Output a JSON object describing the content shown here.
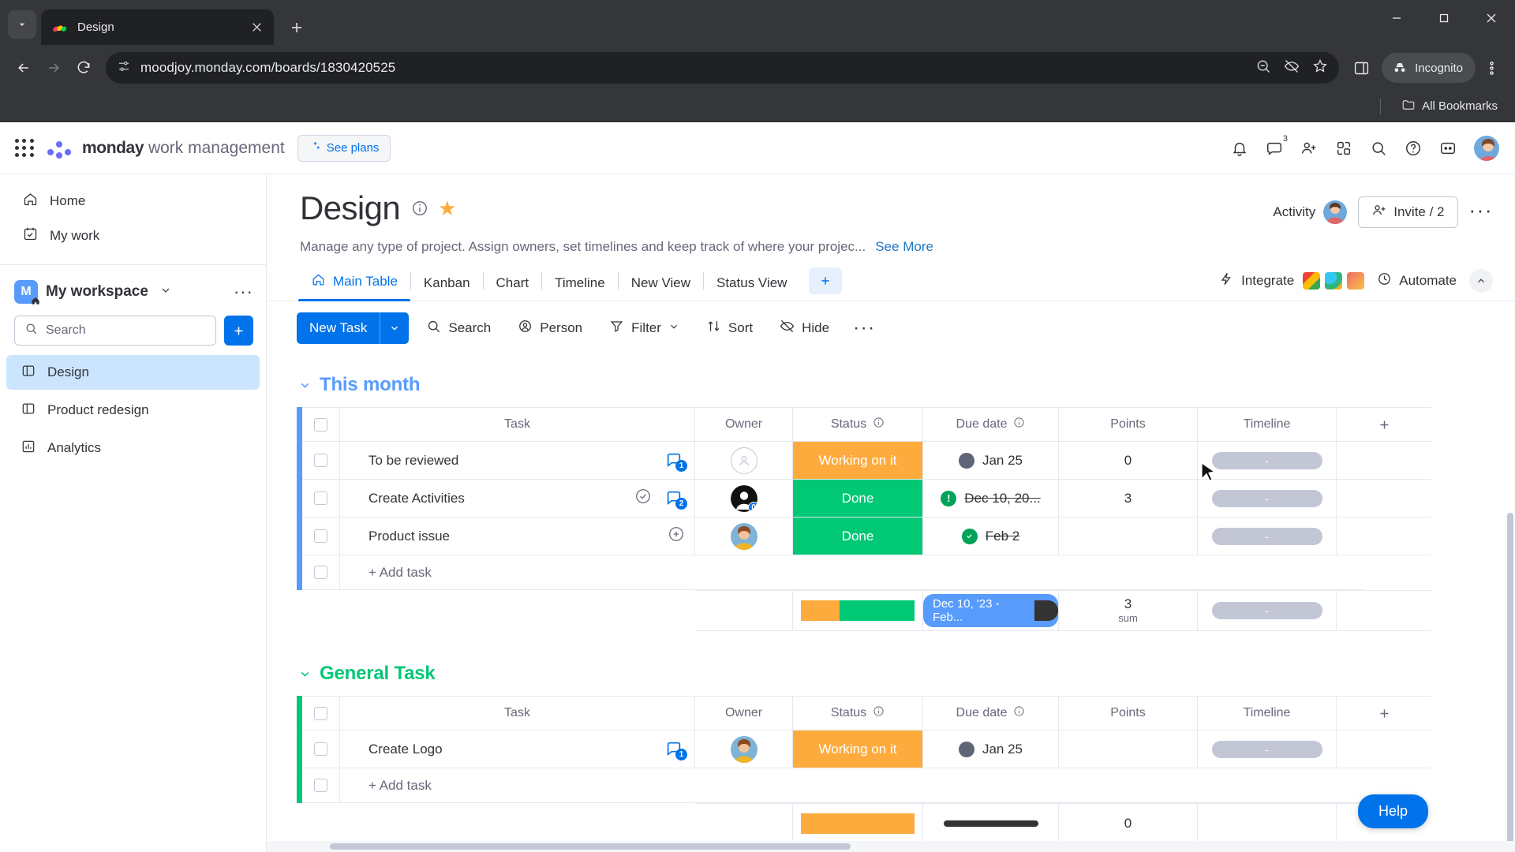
{
  "browser": {
    "tab": {
      "title": "Design",
      "favicon_name": "monday-favicon"
    },
    "url": "moodjoy.monday.com/boards/1830420525",
    "profile_label": "Incognito",
    "bookmarks_label": "All Bookmarks",
    "new_tab_label": "New tab",
    "tab_search_label": "Search tabs",
    "back_label": "Back",
    "forward_label": "Forward",
    "reload_label": "Reload"
  },
  "topbar": {
    "brand_bold": "monday",
    "brand_rest": " work management",
    "see_plans": "See plans",
    "notifications_badge": "3",
    "icons": [
      "bell-icon",
      "inbox-icon",
      "invite-members-icon",
      "apps-icon",
      "search-icon",
      "help-icon",
      "products-icon",
      "profile-avatar"
    ]
  },
  "sidebar": {
    "nav": [
      {
        "label": "Home",
        "icon": "home-icon"
      },
      {
        "label": "My work",
        "icon": "my-work-icon"
      }
    ],
    "workspace": {
      "initial": "M",
      "name": "My workspace"
    },
    "search_placeholder": "Search",
    "search_value": "",
    "boards": [
      {
        "label": "Design",
        "icon": "board-icon",
        "active": true
      },
      {
        "label": "Product redesign",
        "icon": "board-icon",
        "active": false
      },
      {
        "label": "Analytics",
        "icon": "dashboard-icon",
        "active": false
      }
    ]
  },
  "board": {
    "title": "Design",
    "description": "Manage any type of project. Assign owners, set timelines and keep track of where your projec...",
    "see_more": "See More",
    "activity_label": "Activity",
    "invite_label": "Invite / 2",
    "views": [
      {
        "label": "Main Table",
        "icon": "home-icon",
        "active": true
      },
      {
        "label": "Kanban",
        "active": false
      },
      {
        "label": "Chart",
        "active": false
      },
      {
        "label": "Timeline",
        "active": false
      },
      {
        "label": "New View",
        "active": false
      },
      {
        "label": "Status View",
        "active": false
      }
    ],
    "integrate_label": "Integrate",
    "automate_label": "Automate"
  },
  "toolbar": {
    "new_task": "New Task",
    "search": "Search",
    "person": "Person",
    "filter": "Filter",
    "sort": "Sort",
    "hide": "Hide"
  },
  "table": {
    "columns": [
      "Task",
      "Owner",
      "Status",
      "Due date",
      "Points",
      "Timeline"
    ],
    "groups": [
      {
        "name": "This month",
        "color": "#579bfc",
        "add_task_label": "+ Add task",
        "rows": [
          {
            "task": "To be reviewed",
            "conversation_count": "1",
            "has_check_icon": false,
            "owner": "none",
            "status": "Working on it",
            "status_color": "#fdab3d",
            "due_date": "Jan 25",
            "due_state": "pending",
            "due_strike": false,
            "points": "0",
            "timeline": "-"
          },
          {
            "task": "Create Activities",
            "conversation_count": "2",
            "has_check_icon": true,
            "owner": "dark-avatar",
            "owner_badge": "0",
            "status": "Done",
            "status_color": "#00c875",
            "due_date": "Dec 10, 20...",
            "due_state": "overdue",
            "due_strike": true,
            "points": "3",
            "timeline": "-"
          },
          {
            "task": "Product issue",
            "conversation_count": "",
            "has_check_icon": false,
            "owner": "photo-avatar",
            "status": "Done",
            "status_color": "#00c875",
            "due_date": "Feb 2",
            "due_state": "done",
            "due_strike": true,
            "points": "",
            "timeline": "-"
          }
        ],
        "summary": {
          "status_segments": [
            {
              "color": "#fdab3d",
              "pct": 34
            },
            {
              "color": "#00c875",
              "pct": 66
            }
          ],
          "date_range": "Dec 10, '23 - Feb...",
          "points_value": "3",
          "points_label": "sum",
          "timeline": "-"
        }
      },
      {
        "name": "General Task",
        "color": "#00c875",
        "add_task_label": "+ Add task",
        "rows": [
          {
            "task": "Create Logo",
            "conversation_count": "1",
            "has_check_icon": false,
            "owner": "photo-avatar",
            "status": "Working on it",
            "status_color": "#fdab3d",
            "due_date": "Jan 25",
            "due_state": "pending",
            "due_strike": false,
            "points": "",
            "timeline": "-"
          }
        ]
      }
    ]
  },
  "help": {
    "label": "Help"
  },
  "colors": {
    "primary": "#0073ea",
    "orange": "#fdab3d",
    "green": "#00c875",
    "group_blue": "#579bfc",
    "text": "#323338",
    "muted": "#676879"
  }
}
